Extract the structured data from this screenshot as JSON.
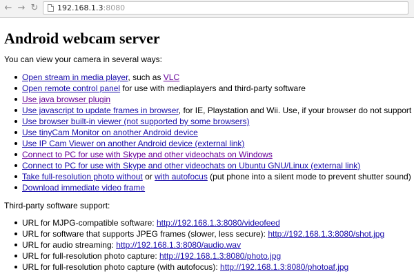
{
  "browser": {
    "url_host": "192.168.1.3",
    "url_port": ":8080"
  },
  "page": {
    "title": "Android webcam server",
    "intro": "You can view your camera in several ways:",
    "ways": [
      {
        "link": "Open stream in media player",
        "text1": ", such as ",
        "link2": "VLC"
      },
      {
        "link": "Open remote control panel",
        "text1": " for use with mediaplayers and third-party software"
      },
      {
        "link": "Use java browser plugin"
      },
      {
        "link": "Use javascript to update frames in browser",
        "text1": ", for IE, Playstation and Wii. Use, if your browser do not support"
      },
      {
        "link": "Use browser built-in viewer (not supported by some browsers)"
      },
      {
        "link": "Use tinyCam Monitor on another Android device"
      },
      {
        "link": "Use IP Cam Viewer on another Android device (external link)"
      },
      {
        "link": "Connect to PC for use with Skype and other videochats on Windows"
      },
      {
        "link": "Connect to PC for use with Skype and other videochats on Ubuntu GNU/Linux (external link)"
      },
      {
        "link": "Take full-resolution photo without",
        "text1": " or ",
        "link2": "with autofocus",
        "text2": " (put phone into a silent mode to prevent shutter sound)"
      },
      {
        "link": "Download immediate video frame"
      }
    ],
    "support_title": "Third-party software support:",
    "support": [
      {
        "text": "URL for MJPG-compatible software: ",
        "link": "http://192.168.1.3:8080/videofeed"
      },
      {
        "text": "URL for software that supports JPEG frames (slower, less secure): ",
        "link": "http://192.168.1.3:8080/shot.jpg"
      },
      {
        "text": "URL for audio streaming: ",
        "link": "http://192.168.1.3:8080/audio.wav"
      },
      {
        "text": "URL for full-resolution photo capture: ",
        "link": "http://192.168.1.3:8080/photo.jpg"
      },
      {
        "text": "URL for full-resolution photo capture (with autofocus): ",
        "link": "http://192.168.1.3:8080/photoaf.jpg"
      }
    ]
  },
  "colors": {
    "link": "#1a0dab",
    "visited": "#660099"
  }
}
